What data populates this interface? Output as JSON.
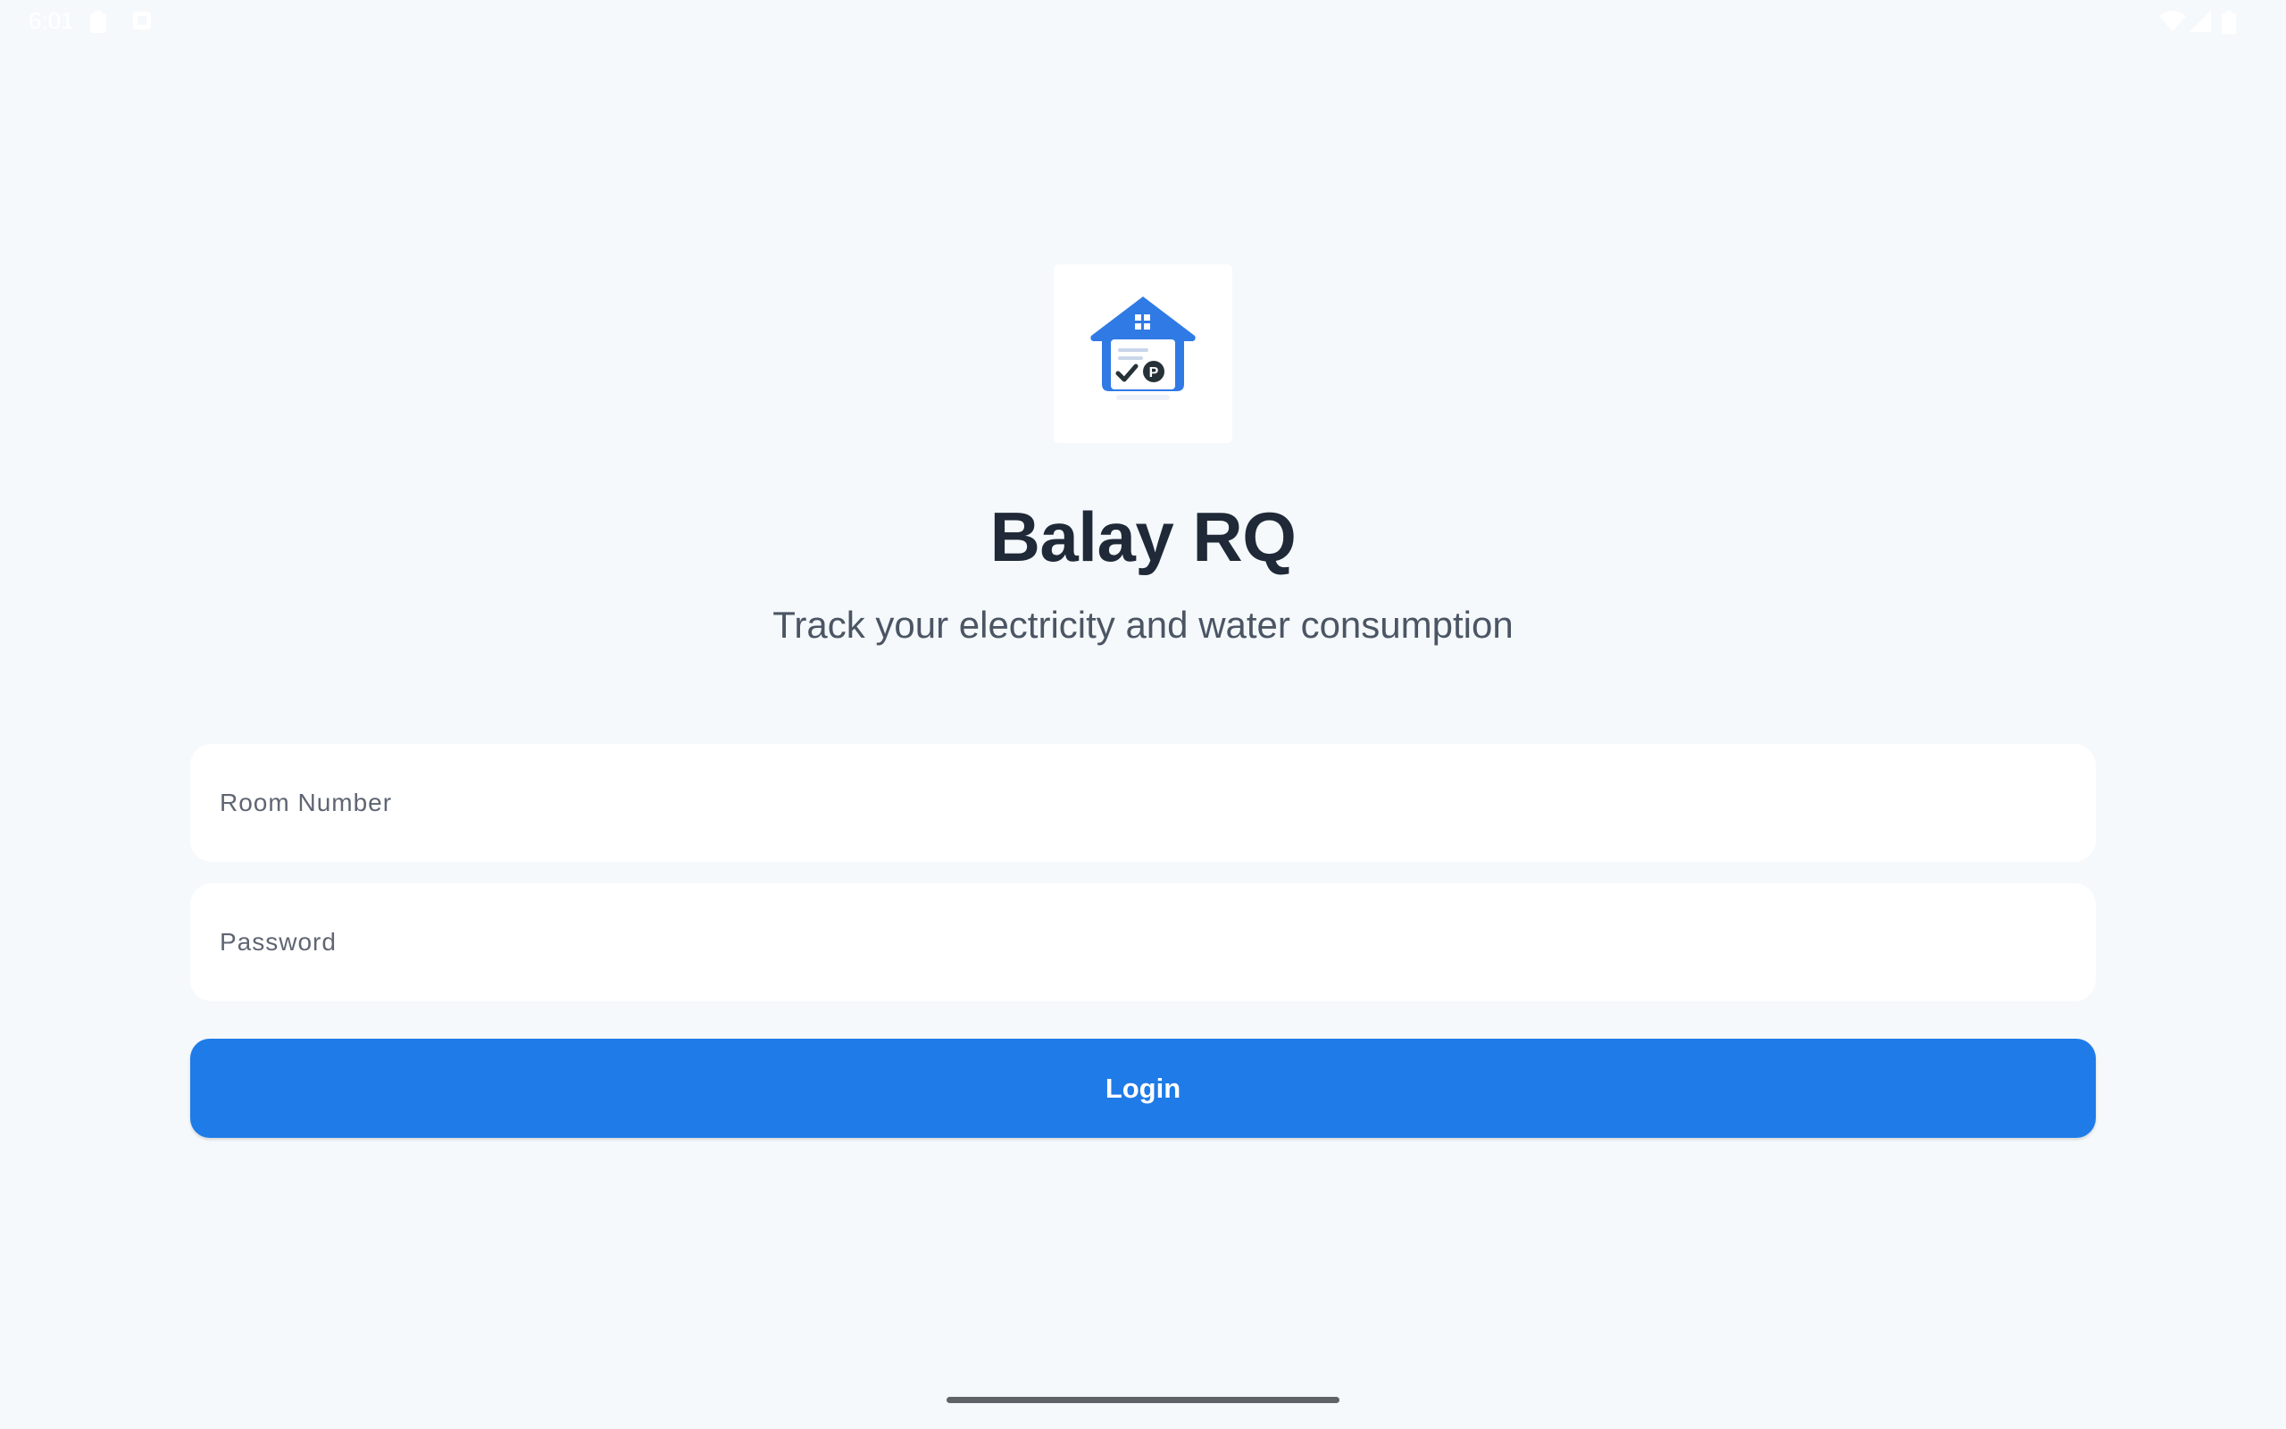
{
  "status_bar": {
    "time": "6:01",
    "icons": [
      "battery-saver-icon",
      "notification-icon",
      "wifi-icon",
      "signal-icon",
      "battery-icon"
    ]
  },
  "app": {
    "logo_icon": "house-bill-check-icon",
    "title": "Balay RQ",
    "subtitle": "Track your electricity and water consumption"
  },
  "form": {
    "room_number": {
      "placeholder": "Room Number",
      "value": ""
    },
    "password": {
      "placeholder": "Password",
      "value": ""
    },
    "login_label": "Login"
  },
  "colors": {
    "background": "#f5f9fc",
    "accent": "#1e7be8",
    "title": "#1f2937",
    "subtitle": "#4b5563"
  }
}
